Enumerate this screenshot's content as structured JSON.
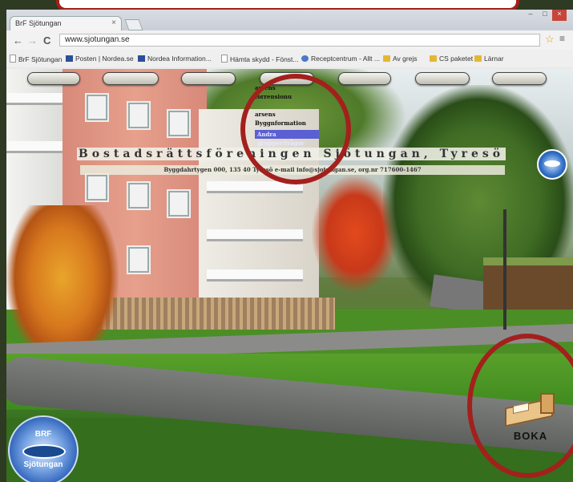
{
  "browser": {
    "tab_title": "BrF Sjötungan",
    "tab_close": "×",
    "window_controls": [
      "–",
      "□",
      "×"
    ],
    "nav": {
      "back": "←",
      "forward": "→",
      "reload": "C"
    },
    "url": "www.sjotungan.se",
    "star": "☆",
    "menu": "≡",
    "bookmarks": [
      {
        "label": "BrF Sjötungan",
        "icon": "doc"
      },
      {
        "label": "Posten | Nordea.se",
        "icon": "flag"
      },
      {
        "label": "Nordea Information...",
        "icon": "flag"
      },
      {
        "label": "Hämta skydd - Fönst...",
        "icon": "doc"
      },
      {
        "label": "Receptcentrum - Allt ...",
        "icon": "globe"
      },
      {
        "label": "Av grejs",
        "icon": "folder"
      },
      {
        "label": "CS paketet",
        "icon": "folder"
      },
      {
        "label": "Lärnar",
        "icon": "folder"
      }
    ]
  },
  "site": {
    "nav_buttons": [
      "",
      "",
      "",
      "",
      "",
      "",
      ""
    ],
    "dropdown": {
      "items": [
        "arsens",
        "forrensionu",
        "",
        "arsens",
        "Byggnformation"
      ],
      "selected": "Andra grupper/frågor"
    },
    "title": "Bostadsrättsföreningen Sjötungan, Tyresö",
    "subtitle": "Byggdahrtygen 000, 135 40 Tyresö   e-mail info@sjotungan.se, org.nr 717600-1467",
    "logo": {
      "top": "BRF",
      "bottom": "Sjötungan"
    },
    "boka_label": "BOKA"
  },
  "colors": {
    "annotation_red": "#a3201c",
    "dropdown_selected": "#5a5fd3"
  }
}
